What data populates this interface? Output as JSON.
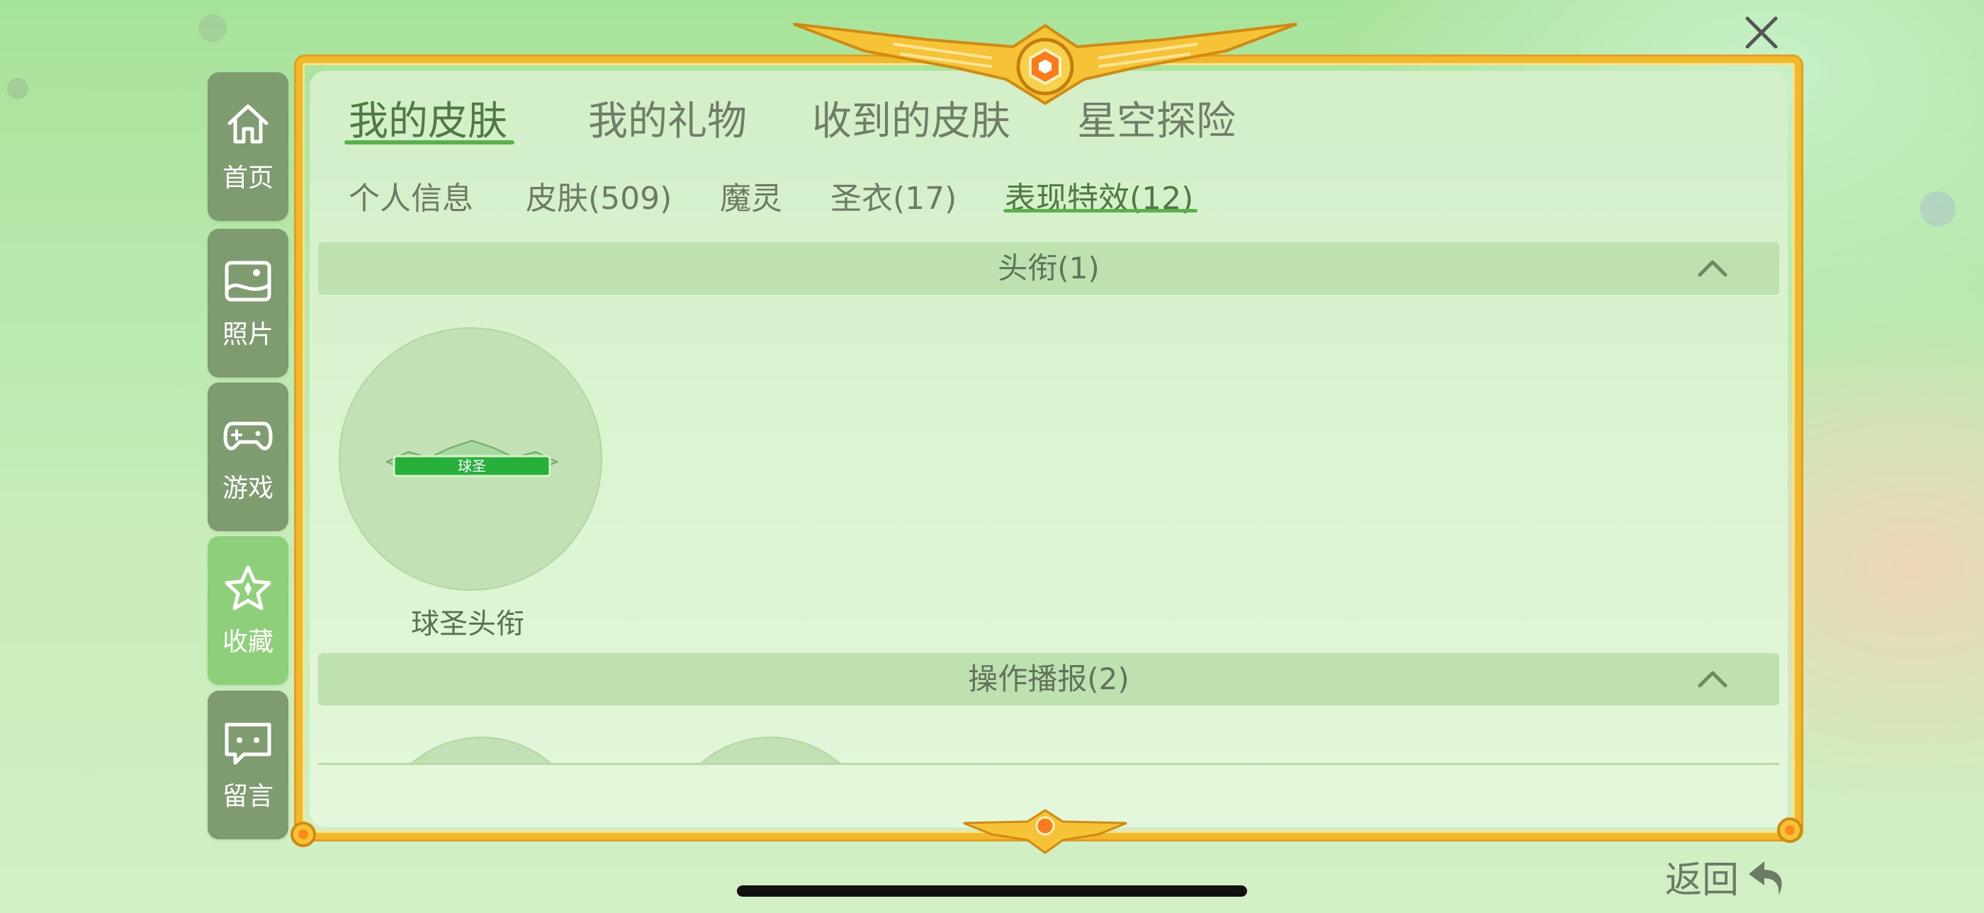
{
  "sidebar": {
    "items": [
      {
        "label": "首页",
        "icon": "home-icon",
        "active": false
      },
      {
        "label": "照片",
        "icon": "photo-icon",
        "active": false
      },
      {
        "label": "游戏",
        "icon": "gamepad-icon",
        "active": false
      },
      {
        "label": "收藏",
        "icon": "star-icon",
        "active": true
      },
      {
        "label": "留言",
        "icon": "message-icon",
        "active": false
      }
    ]
  },
  "tabs": [
    {
      "label": "我的皮肤",
      "active": true
    },
    {
      "label": "我的礼物",
      "active": false
    },
    {
      "label": "收到的皮肤",
      "active": false
    },
    {
      "label": "星空探险",
      "active": false
    }
  ],
  "subtabs": [
    {
      "label": "个人信息",
      "active": false
    },
    {
      "label": "皮肤(509)",
      "active": false
    },
    {
      "label": "魔灵",
      "active": false
    },
    {
      "label": "圣衣(17)",
      "active": false
    },
    {
      "label": "表现特效(12)",
      "active": true
    }
  ],
  "sections": [
    {
      "title": "头衔(1)",
      "items": [
        {
          "label": "球圣头衔",
          "badge_text": "球圣"
        }
      ]
    },
    {
      "title": "操作播报(2)",
      "items": [
        {
          "label": ""
        },
        {
          "label": ""
        }
      ]
    }
  ],
  "back_label": "返回",
  "colors": {
    "gold_frame": "#f2b82c",
    "active_underline": "#5ab14d",
    "sidebar_bg": "#7f9c70",
    "sidebar_active": "#8ed07a"
  }
}
